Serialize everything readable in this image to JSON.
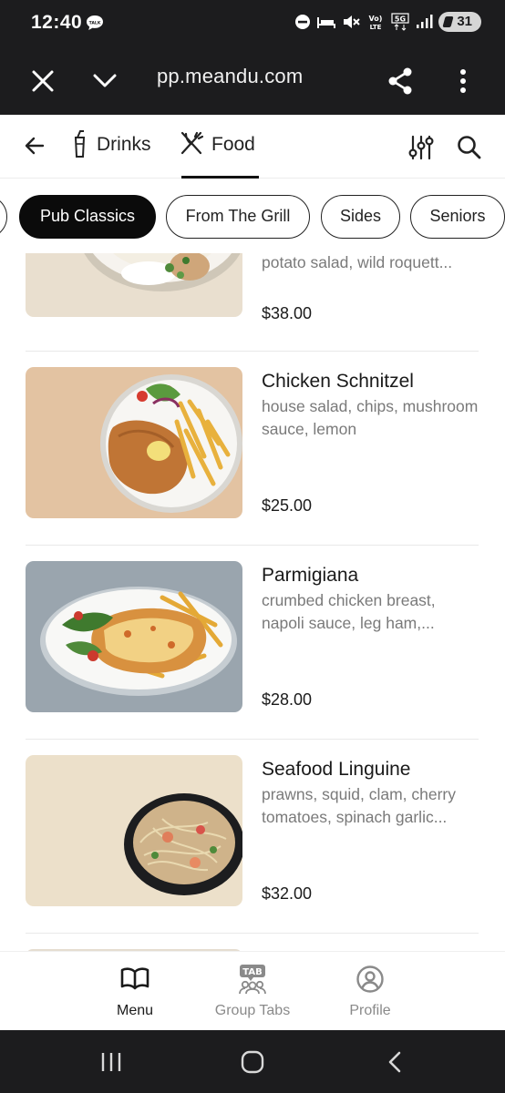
{
  "status_bar": {
    "time": "12:40",
    "talk_badge": "TALK",
    "network_labels": [
      "Vo) LTE",
      "5G"
    ],
    "battery": "31"
  },
  "browser": {
    "url": "pp.meandu.com",
    "icons": [
      "close-icon",
      "chevron-down-icon",
      "share-icon",
      "more-vertical-icon"
    ]
  },
  "top_nav": {
    "tabs": [
      {
        "label": "Drinks",
        "icon": "drink-icon",
        "active": false
      },
      {
        "label": "Food",
        "icon": "cutlery-icon",
        "active": true
      }
    ]
  },
  "categories": {
    "items": [
      {
        "label": "Pub Classics",
        "active": true
      },
      {
        "label": "From The Grill",
        "active": false
      },
      {
        "label": "Sides",
        "active": false
      },
      {
        "label": "Seniors",
        "active": false
      }
    ]
  },
  "menu": {
    "items": [
      {
        "name": "",
        "desc": "potato salad, wild roquett...",
        "price": "$38.00"
      },
      {
        "name": "Chicken Schnitzel",
        "desc": "house salad, chips, mushroom sauce, lemon",
        "price": "$25.00"
      },
      {
        "name": "Parmigiana",
        "desc": "crumbed chicken breast, napoli sauce, leg ham,...",
        "price": "$28.00"
      },
      {
        "name": "Seafood Linguine",
        "desc": "prawns, squid, clam, cherry tomatoes, spinach garlic...",
        "price": "$32.00"
      }
    ]
  },
  "bottom_nav": {
    "items": [
      {
        "label": "Menu",
        "active": true
      },
      {
        "label": "Group Tabs",
        "badge": "TAB",
        "active": false
      },
      {
        "label": "Profile",
        "active": false
      }
    ]
  },
  "colors": {
    "active_pill": "#0b0b0b",
    "muted_text": "#7a7a7a",
    "system_bar": "#1c1c1e"
  }
}
